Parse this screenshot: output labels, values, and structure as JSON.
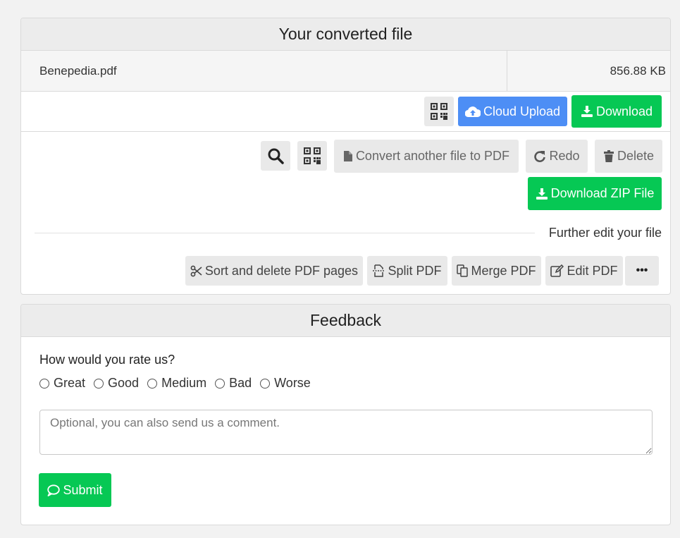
{
  "file_card": {
    "title": "Your converted file",
    "file_name": "Benepedia.pdf",
    "file_size": "856.88 KB",
    "cloud_upload_label": "Cloud Upload",
    "download_label": "Download",
    "convert_another_label": "Convert another file to PDF",
    "redo_label": "Redo",
    "delete_label": "Delete",
    "download_zip_label": "Download ZIP File",
    "further_edit_label": "Further edit your file",
    "tools": [
      {
        "label": "Sort and delete PDF pages",
        "icon": "scissors-icon"
      },
      {
        "label": "Split PDF",
        "icon": "split-icon"
      },
      {
        "label": "Merge PDF",
        "icon": "merge-icon"
      },
      {
        "label": "Edit PDF",
        "icon": "edit-icon"
      }
    ],
    "more_label": "•••"
  },
  "feedback": {
    "title": "Feedback",
    "question": "How would you rate us?",
    "options": [
      "Great",
      "Good",
      "Medium",
      "Bad",
      "Worse"
    ],
    "comment_placeholder": "Optional, you can also send us a comment.",
    "submit_label": "Submit"
  },
  "colors": {
    "green": "#06c854",
    "blue": "#4d8ef5",
    "gray_button": "#e9e9e9"
  }
}
